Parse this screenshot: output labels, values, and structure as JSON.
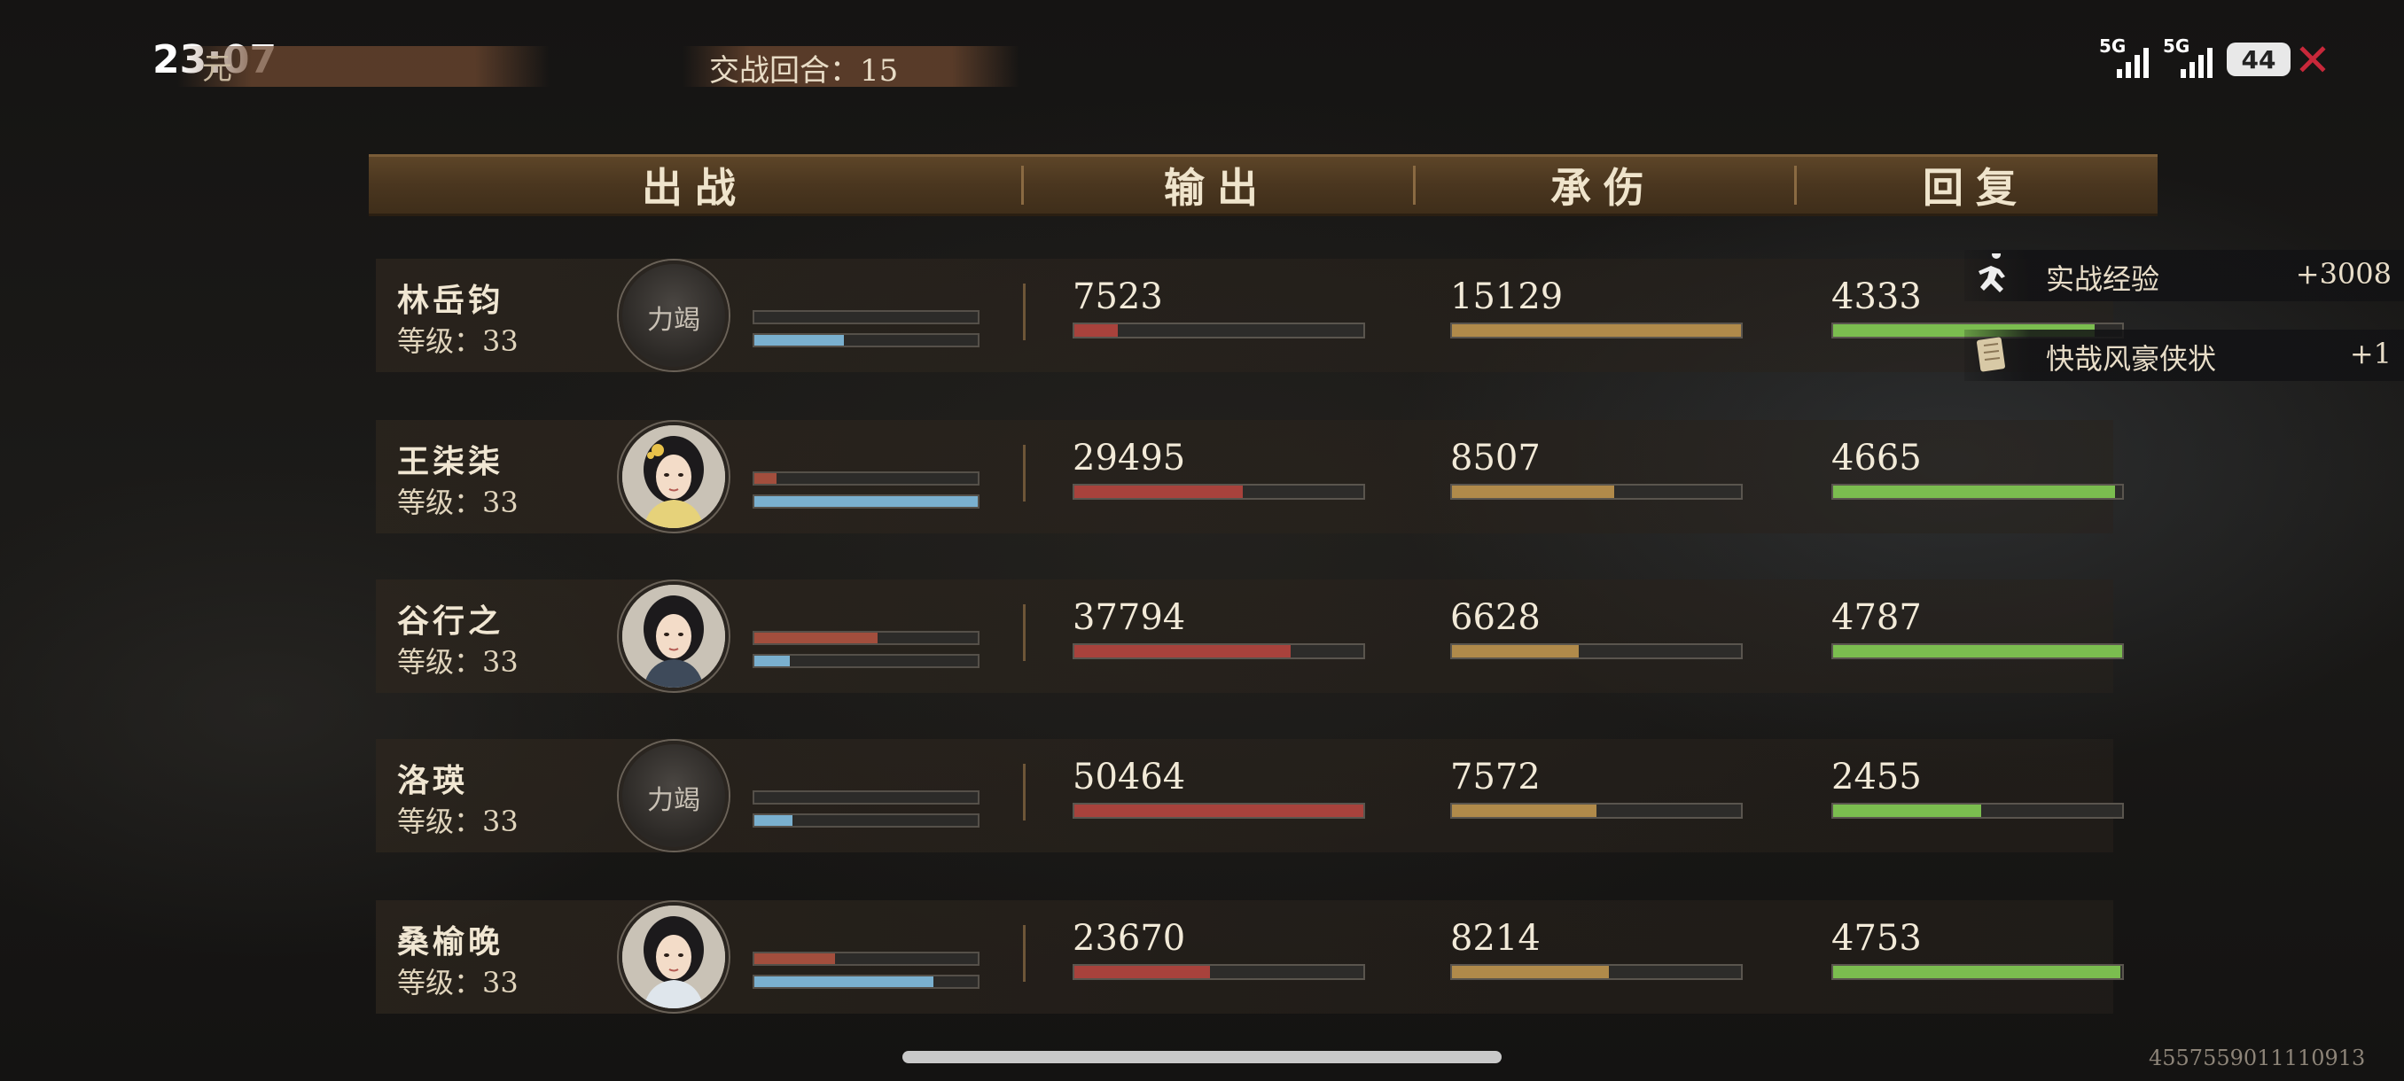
{
  "status_bar": {
    "time": "23:07",
    "signal1": "5G",
    "signal2": "5G",
    "battery": "44"
  },
  "top": {
    "left_label": "元",
    "round_label": "交战回合：15"
  },
  "header": {
    "col1": "出战",
    "col2": "输出",
    "col3": "承伤",
    "col4": "回复"
  },
  "rows": [
    {
      "name": "林岳钧",
      "level": "等级：33",
      "avatar_text": "力竭",
      "avatar_type": "dark",
      "output": "7523",
      "damage_taken": "15129",
      "heal": "4333",
      "mini_red": 0,
      "mini_blue": 0.4,
      "output_frac": 0.149,
      "dmg_frac": 1.0,
      "heal_frac": 0.905
    },
    {
      "name": "王柒柒",
      "level": "等级：33",
      "avatar_text": "",
      "avatar_type": "portrait-girl",
      "output": "29495",
      "damage_taken": "8507",
      "heal": "4665",
      "mini_red": 0.1,
      "mini_blue": 1.0,
      "output_frac": 0.584,
      "dmg_frac": 0.562,
      "heal_frac": 0.974
    },
    {
      "name": "谷行之",
      "level": "等级：33",
      "avatar_text": "",
      "avatar_type": "portrait-boy",
      "output": "37794",
      "damage_taken": "6628",
      "heal": "4787",
      "mini_red": 0.55,
      "mini_blue": 0.16,
      "output_frac": 0.749,
      "dmg_frac": 0.438,
      "heal_frac": 1.0
    },
    {
      "name": "洛瑛",
      "level": "等级：33",
      "avatar_text": "力竭",
      "avatar_type": "dark",
      "output": "50464",
      "damage_taken": "7572",
      "heal": "2455",
      "mini_red": 0,
      "mini_blue": 0.17,
      "output_frac": 1.0,
      "dmg_frac": 0.5,
      "heal_frac": 0.513
    },
    {
      "name": "桑榆晚",
      "level": "等级：33",
      "avatar_text": "",
      "avatar_type": "portrait-woman",
      "output": "23670",
      "damage_taken": "8214",
      "heal": "4753",
      "mini_red": 0.36,
      "mini_blue": 0.8,
      "output_frac": 0.469,
      "dmg_frac": 0.543,
      "heal_frac": 0.993
    }
  ],
  "rewards": [
    {
      "label": "实战经验",
      "value": "+3008",
      "icon": "runner-icon"
    },
    {
      "label": "快哉风豪侠状",
      "value": "+1",
      "icon": "scroll-icon"
    }
  ],
  "uid": "4557559011110913"
}
